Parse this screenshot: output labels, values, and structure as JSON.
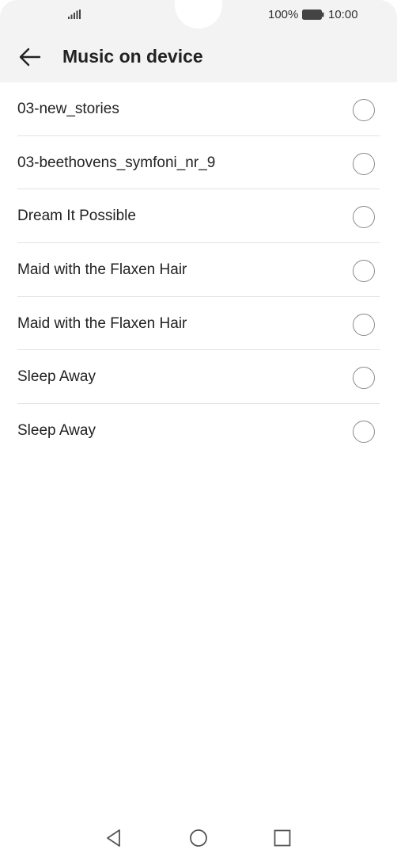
{
  "status_bar": {
    "battery_percent": "100%",
    "time": "10:00",
    "signal_icon": "signal-icon",
    "battery_icon": "battery-icon"
  },
  "header": {
    "title": "Music on device",
    "back_icon": "arrow-left-icon"
  },
  "songs": [
    {
      "title": "03-new_stories",
      "selected": false
    },
    {
      "title": "03-beethovens_symfoni_nr_9",
      "selected": false
    },
    {
      "title": "Dream It Possible",
      "selected": false
    },
    {
      "title": "Maid with the Flaxen Hair",
      "selected": false
    },
    {
      "title": "Maid with the Flaxen Hair",
      "selected": false
    },
    {
      "title": "Sleep Away",
      "selected": false
    },
    {
      "title": "Sleep Away",
      "selected": false
    }
  ],
  "nav": {
    "back_icon": "triangle-back-icon",
    "home_icon": "circle-home-icon",
    "recents_icon": "square-recents-icon"
  }
}
